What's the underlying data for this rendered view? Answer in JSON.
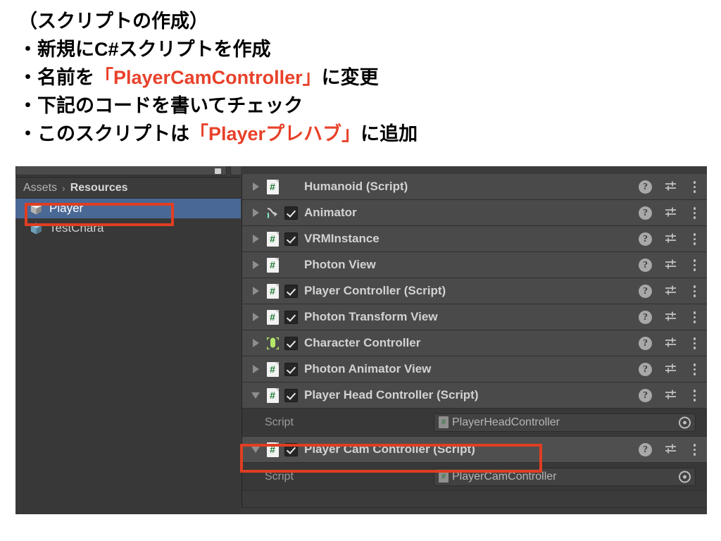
{
  "slide": {
    "lines": [
      {
        "id": "title",
        "segments": [
          {
            "text": "（スクリプトの作成）",
            "accent": false
          }
        ]
      },
      {
        "id": "bullet-1",
        "segments": [
          {
            "text": "・新規にC#スクリプトを作成",
            "accent": false
          }
        ]
      },
      {
        "id": "bullet-2",
        "segments": [
          {
            "text": "・名前を",
            "accent": false
          },
          {
            "text": "「PlayerCamController」",
            "accent": true
          },
          {
            "text": "に変更",
            "accent": false
          }
        ]
      },
      {
        "id": "bullet-3",
        "segments": [
          {
            "text": "・下記のコードを書いてチェック",
            "accent": false
          }
        ]
      },
      {
        "id": "bullet-4",
        "segments": [
          {
            "text": "・このスクリプトは",
            "accent": false
          },
          {
            "text": "「Playerプレハブ」",
            "accent": true
          },
          {
            "text": "に追加",
            "accent": false
          }
        ]
      }
    ],
    "accent_color": "#E8412A",
    "text_color": "#000000"
  },
  "project_panel": {
    "breadcrumb": {
      "root": "Assets",
      "separator": "›",
      "current": "Resources"
    },
    "assets": [
      {
        "label": "Player",
        "icon": "prefab-cube-icon",
        "selected": true,
        "icon_color": "#e8e8e8"
      },
      {
        "label": "TestChara",
        "icon": "prefab-cube-icon",
        "selected": false,
        "icon_color": "#8fcdf0"
      }
    ],
    "selection_color": "#4a6896"
  },
  "inspector": {
    "components": [
      {
        "name": "Humanoid (Script)",
        "icon": "script-icon",
        "expanded": false,
        "has_checkbox": false,
        "checked": false,
        "highlighted": false
      },
      {
        "name": "Animator",
        "icon": "animator-icon",
        "expanded": false,
        "has_checkbox": true,
        "checked": true,
        "highlighted": false
      },
      {
        "name": "VRMInstance",
        "icon": "script-icon",
        "expanded": false,
        "has_checkbox": true,
        "checked": true,
        "highlighted": false
      },
      {
        "name": "Photon View",
        "icon": "script-icon",
        "expanded": false,
        "has_checkbox": false,
        "checked": false,
        "highlighted": false
      },
      {
        "name": "Player Controller (Script)",
        "icon": "script-icon",
        "expanded": false,
        "has_checkbox": true,
        "checked": true,
        "highlighted": false
      },
      {
        "name": "Photon Transform View",
        "icon": "script-icon",
        "expanded": false,
        "has_checkbox": true,
        "checked": true,
        "highlighted": false
      },
      {
        "name": "Character Controller",
        "icon": "character-controller-icon",
        "expanded": false,
        "has_checkbox": true,
        "checked": true,
        "highlighted": false
      },
      {
        "name": "Photon Animator View",
        "icon": "script-icon",
        "expanded": false,
        "has_checkbox": true,
        "checked": true,
        "highlighted": false
      },
      {
        "name": "Player Head Controller (Script)",
        "icon": "script-icon",
        "expanded": true,
        "has_checkbox": true,
        "checked": true,
        "highlighted": false,
        "property": {
          "label": "Script",
          "value": "PlayerHeadController"
        }
      },
      {
        "name": "Player Cam Controller (Script)",
        "icon": "script-icon",
        "expanded": true,
        "has_checkbox": true,
        "checked": true,
        "highlighted": true,
        "property": {
          "label": "Script",
          "value": "PlayerCamController"
        }
      }
    ],
    "row_actions": {
      "help": "?",
      "preset": "preset-icon",
      "menu": "kebab-menu-icon"
    }
  },
  "annotations": [
    {
      "id": "annot-player",
      "target": "Player asset row",
      "color": "#E03E22"
    },
    {
      "id": "annot-camctrl",
      "target": "Player Cam Controller (Script) header",
      "color": "#E03E22"
    }
  ]
}
